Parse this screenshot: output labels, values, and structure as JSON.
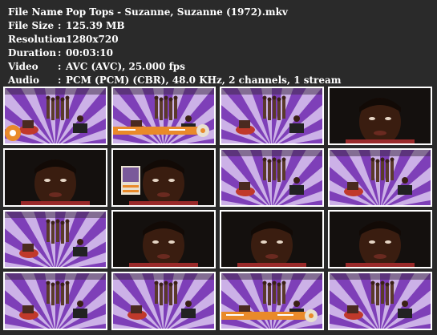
{
  "file_info": {
    "filename": {
      "label": "File Name",
      "sep": ":",
      "value": "Pop Tops - Suzanne, Suzanne (1972).mkv"
    },
    "filesize": {
      "label": "File Size",
      "sep": ":",
      "value": "125.39 MB"
    },
    "resolution": {
      "label": "Resolution",
      "sep": ":",
      "value": "1280x720"
    },
    "duration": {
      "label": "Duration",
      "sep": ":",
      "value": "00:03:10"
    },
    "video": {
      "label": "Video",
      "sep": ":",
      "value": "AVC (AVC), 25.000 fps"
    },
    "audio": {
      "label": "Audio",
      "sep": ":",
      "value": "PCM (PCM) (CBR), 48.0 KHz, 2 channels, 1 stream"
    }
  },
  "thumbnails": [
    {
      "scene": "stage",
      "overlay": "badge"
    },
    {
      "scene": "stage",
      "overlay": "banner"
    },
    {
      "scene": "stage",
      "overlay": "none"
    },
    {
      "scene": "face",
      "overlay": "none"
    },
    {
      "scene": "face",
      "overlay": "none"
    },
    {
      "scene": "face",
      "overlay": "card"
    },
    {
      "scene": "stage",
      "overlay": "none"
    },
    {
      "scene": "stage",
      "overlay": "none"
    },
    {
      "scene": "stage",
      "overlay": "none"
    },
    {
      "scene": "face",
      "overlay": "none"
    },
    {
      "scene": "face",
      "overlay": "none"
    },
    {
      "scene": "face",
      "overlay": "none"
    },
    {
      "scene": "stage",
      "overlay": "none"
    },
    {
      "scene": "stage",
      "overlay": "none"
    },
    {
      "scene": "stage",
      "overlay": "banner"
    },
    {
      "scene": "stage",
      "overlay": "none"
    }
  ],
  "colors": {
    "background": "#2a2a2a",
    "text": "#ffffff",
    "thumb_border": "#ffffff",
    "stage_purple": "#7e3fb8",
    "stage_light": "#d9c6ef",
    "overlay_orange": "#e98a2a",
    "face_dark": "#3a1d10",
    "shirt_red": "#9a2a2a"
  }
}
